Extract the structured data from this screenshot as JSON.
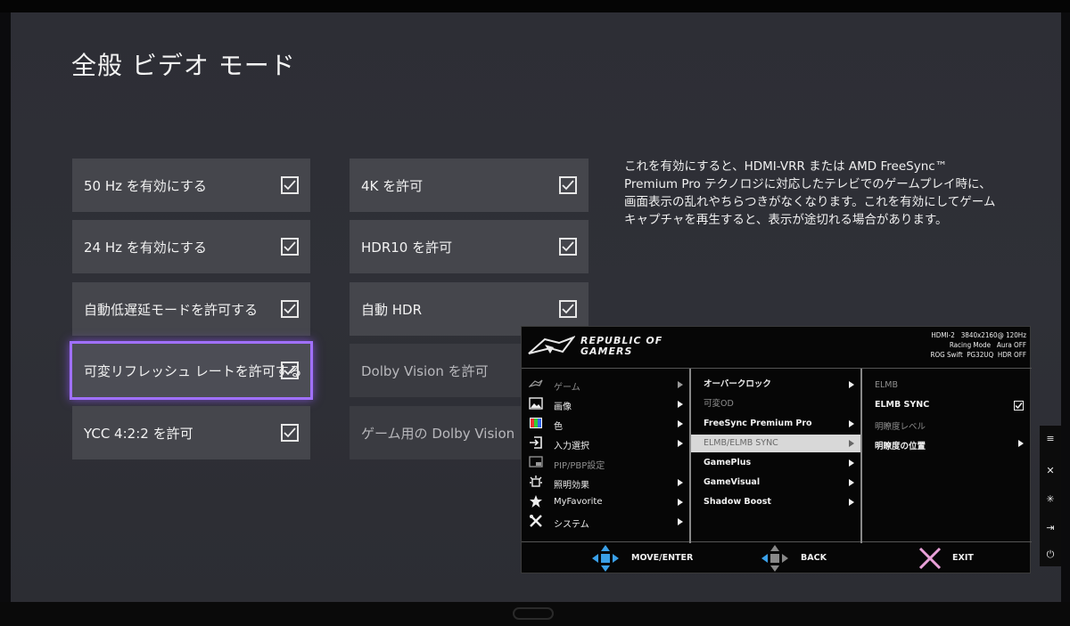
{
  "page": {
    "title": "全般 ビデオ モード"
  },
  "options": {
    "col1": [
      {
        "label": "50 Hz を有効にする",
        "checked": true
      },
      {
        "label": "24 Hz を有効にする",
        "checked": true
      },
      {
        "label": "自動低遅延モードを許可する",
        "checked": true
      },
      {
        "label": "可変リフレッシュ レートを許可する",
        "checked": true,
        "focused": true
      },
      {
        "label": "YCC 4:2:2 を許可",
        "checked": true
      }
    ],
    "col2": [
      {
        "label": "4K を許可",
        "checked": true
      },
      {
        "label": "HDR10 を許可",
        "checked": true
      },
      {
        "label": "自動 HDR",
        "checked": true
      },
      {
        "label": "Dolby Vision を許可",
        "checked": false,
        "disabled": true
      },
      {
        "label": "ゲーム用の Dolby Vision",
        "checked": false,
        "disabled": true
      }
    ]
  },
  "description": {
    "lines": [
      "これを有効にすると、HDMI-VRR または AMD FreeSync™",
      "Premium Pro テクノロジに対応したテレビでのゲームプレイ時に、",
      "画面表示の乱れやちらつきがなくなります。これを有効にしてゲーム",
      "キャプチャを再生すると、表示が途切れる場合があります。"
    ]
  },
  "osd": {
    "brand_line1": "REPUBLIC OF",
    "brand_line2": "GAMERS",
    "status": {
      "line1_a": "HDMI-2",
      "line1_b": "3840x2160@ 120Hz",
      "line2_a": "Racing Mode",
      "line2_b": "Aura OFF",
      "line3_a": "ROG Swift",
      "line3_b": "PG32UQ",
      "line3_c": "HDR OFF"
    },
    "menu1": [
      {
        "label": "ゲーム",
        "icon": "gamepad-icon",
        "dim": true,
        "arrow": true
      },
      {
        "label": "画像",
        "icon": "image-icon",
        "arrow": true
      },
      {
        "label": "色",
        "icon": "color-icon",
        "arrow": true
      },
      {
        "label": "入力選択",
        "icon": "input-icon",
        "arrow": true
      },
      {
        "label": "PIP/PBP設定",
        "icon": "pip-icon",
        "dim": true,
        "arrow": false
      },
      {
        "label": "照明効果",
        "icon": "lighting-icon",
        "arrow": true
      },
      {
        "label": "MyFavorite",
        "icon": "star-icon",
        "arrow": true
      },
      {
        "label": "システム",
        "icon": "tools-icon",
        "arrow": true
      }
    ],
    "menu2": [
      {
        "label": "オーバークロック",
        "arrow": true
      },
      {
        "label": "可変OD",
        "dim": true,
        "arrow": false
      },
      {
        "label": "FreeSync Premium Pro",
        "arrow": true
      },
      {
        "label": "ELMB/ELMB SYNC",
        "selected": true,
        "arrow": true
      },
      {
        "label": "GamePlus",
        "arrow": true
      },
      {
        "label": "GameVisual",
        "arrow": true
      },
      {
        "label": "Shadow Boost",
        "arrow": true
      }
    ],
    "menu3": [
      {
        "label": "ELMB",
        "dim": true
      },
      {
        "label": "ELMB SYNC",
        "checked": true
      },
      {
        "label": "明瞭度レベル",
        "dim": true
      },
      {
        "label": "明瞭度の位置",
        "arrow": true
      }
    ],
    "footer": {
      "move": "MOVE/ENTER",
      "back": "BACK",
      "exit": "EXIT"
    }
  },
  "colors": {
    "focus_ring": "#a070ff",
    "tile_bg": "#45464c",
    "screen_bg": "#2e2f36",
    "osd_arrow_blue": "#3aa0e8",
    "osd_exit_pink": "#e8a0d8"
  }
}
